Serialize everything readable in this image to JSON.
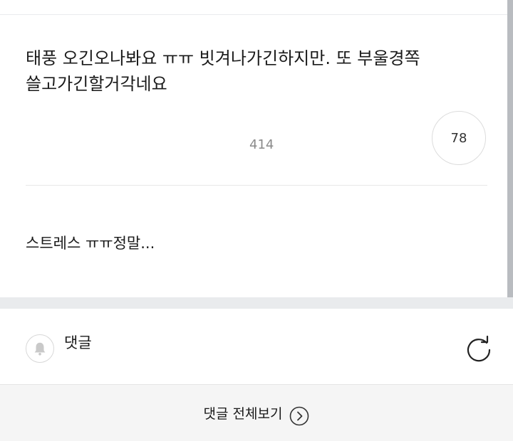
{
  "post": {
    "text": "태풍 오긴오나봐요 ㅠㅠ 빗겨나가긴하지만. 또 부울경쪽 쓸고가긴할거각네요",
    "views": "414",
    "likes": "78"
  },
  "second_post": {
    "text": "스트레스 ㅠㅠ정말..."
  },
  "comments": {
    "label": "댓글",
    "icons": {
      "bell": "bell-icon",
      "refresh": "refresh-icon"
    }
  },
  "footer": {
    "label": "댓글 전체보기",
    "icon": "chevron-right-circle-icon"
  },
  "colors": {
    "divider": "#e8e8e8",
    "band": "#e9ebed",
    "footer_bg": "#f5f5f5",
    "muted_text": "#8a8a8a"
  }
}
